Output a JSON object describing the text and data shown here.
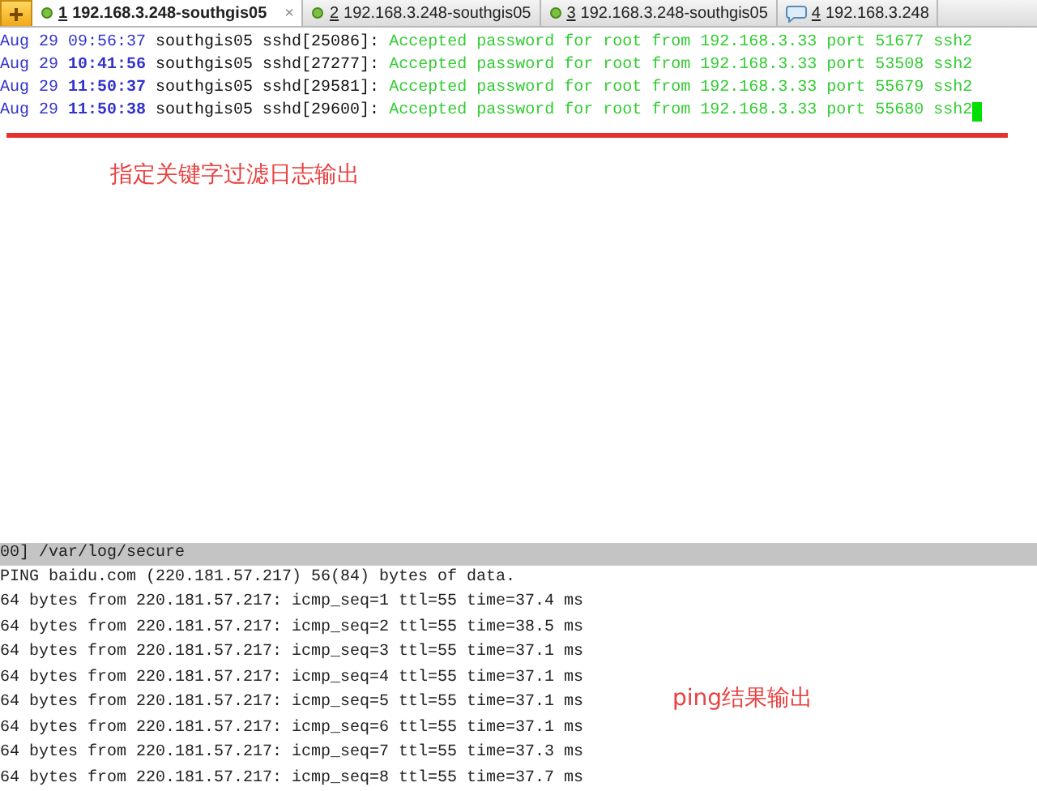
{
  "tabs": [
    {
      "number": "1",
      "label": "192.168.3.248-southgis05",
      "kind": "dot",
      "selected": true,
      "close": "×"
    },
    {
      "number": "2",
      "label": "192.168.3.248-southgis05",
      "kind": "dot",
      "selected": false
    },
    {
      "number": "3",
      "label": "192.168.3.248-southgis05",
      "kind": "dot",
      "selected": false
    },
    {
      "number": "4",
      "label": "192.168.3.248",
      "kind": "chat",
      "selected": false
    }
  ],
  "log_lines": [
    {
      "date": "Aug 29",
      "time": "09:56:37",
      "host": "southgis05",
      "process": "sshd[25086]:",
      "message": "Accepted password for root from 192.168.3.33 port 51677 ssh2"
    },
    {
      "date": "Aug 29",
      "time": "10:41:56",
      "host": "southgis05",
      "process": "sshd[27277]:",
      "message": "Accepted password for root from 192.168.3.33 port 53508 ssh2"
    },
    {
      "date": "Aug 29",
      "time": "11:50:37",
      "host": "southgis05",
      "process": "sshd[29581]:",
      "message": "Accepted password for root from 192.168.3.33 port 55679 ssh2"
    },
    {
      "date": "Aug 29",
      "time": "11:50:38",
      "host": "southgis05",
      "process": "sshd[29600]:",
      "message": "Accepted password for root from 192.168.3.33 port 55680 ssh2"
    }
  ],
  "annotation_top": "指定关键字过滤日志输出",
  "lower_pane": {
    "title": "00] /var/log/secure",
    "lines": [
      "PING baidu.com (220.181.57.217) 56(84) bytes of data.",
      "64 bytes from 220.181.57.217: icmp_seq=1 ttl=55 time=37.4 ms",
      "64 bytes from 220.181.57.217: icmp_seq=2 ttl=55 time=38.5 ms",
      "64 bytes from 220.181.57.217: icmp_seq=3 ttl=55 time=37.1 ms",
      "64 bytes from 220.181.57.217: icmp_seq=4 ttl=55 time=37.1 ms",
      "64 bytes from 220.181.57.217: icmp_seq=5 ttl=55 time=37.1 ms",
      "64 bytes from 220.181.57.217: icmp_seq=6 ttl=55 time=37.1 ms",
      "64 bytes from 220.181.57.217: icmp_seq=7 ttl=55 time=37.3 ms",
      "64 bytes from 220.181.57.217: icmp_seq=8 ttl=55 time=37.7 ms"
    ],
    "annotation": "ping结果输出"
  }
}
